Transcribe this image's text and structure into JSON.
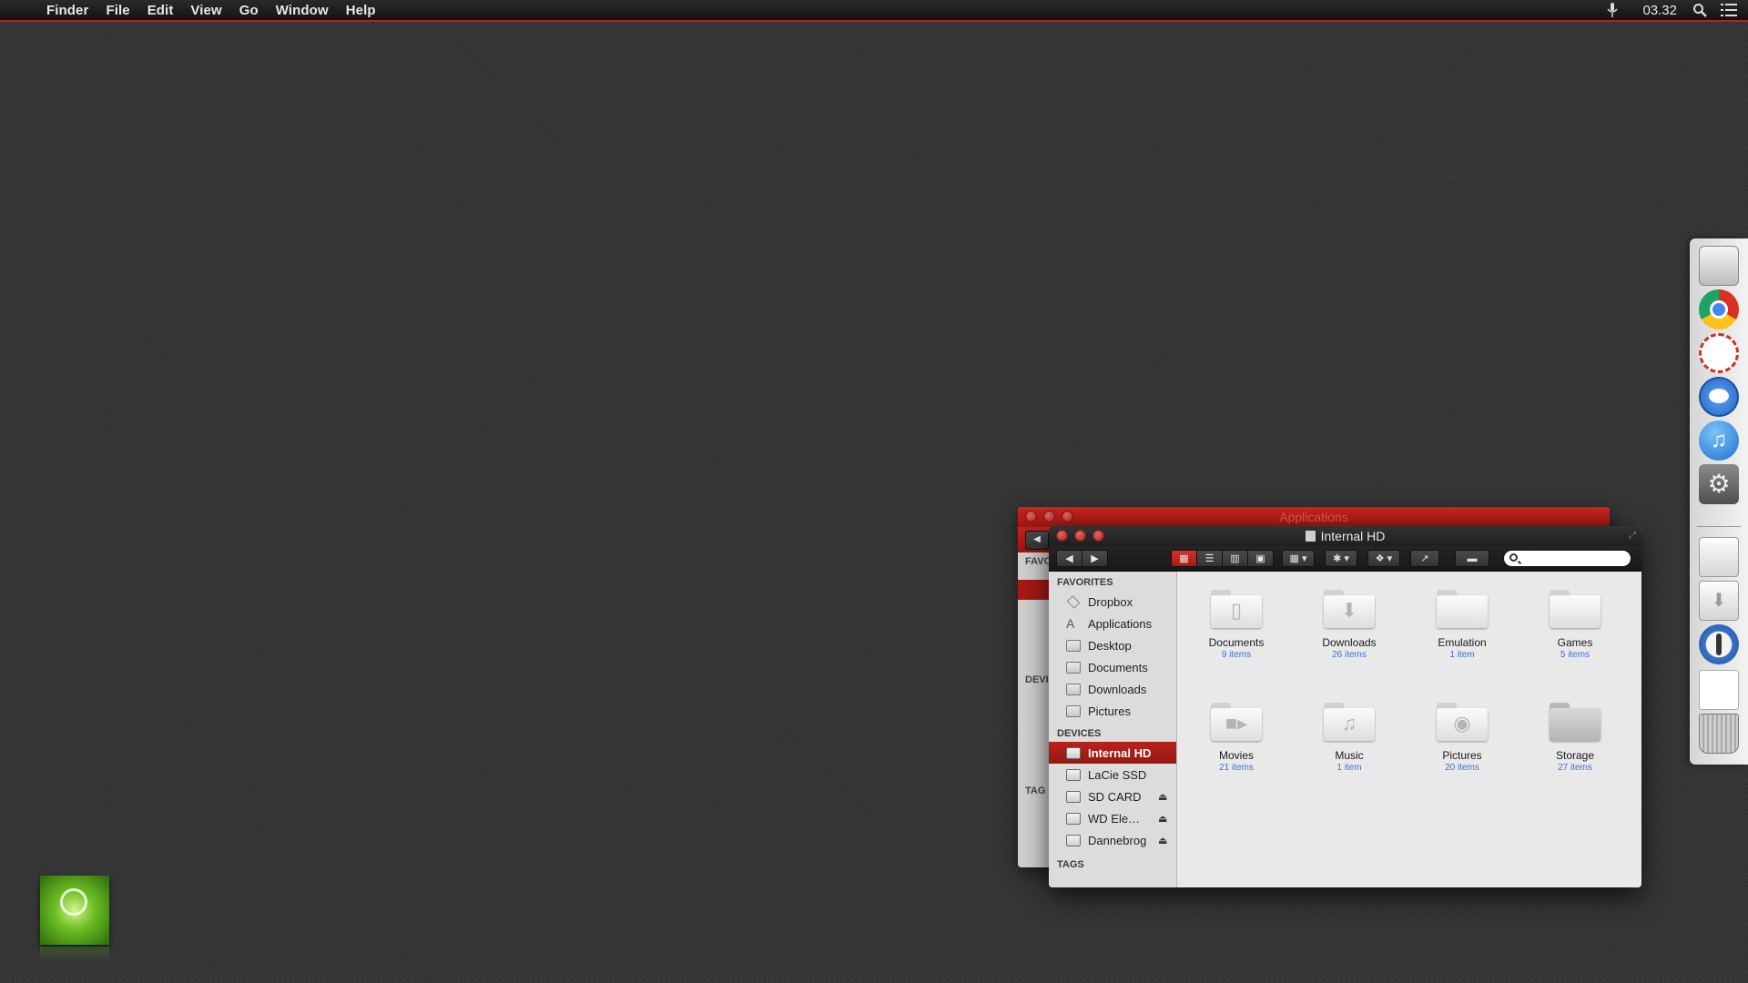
{
  "menubar": {
    "apple": "",
    "items": [
      "Finder",
      "File",
      "Edit",
      "View",
      "Go",
      "Window",
      "Help"
    ],
    "clock": "03.32"
  },
  "back_window": {
    "title": "Applications",
    "sidebar_fav": "FAVO",
    "sidebar_dev": "DEVI",
    "sidebar_tags": "TAG"
  },
  "window": {
    "title": "Internal HD",
    "sidebar": {
      "favorites_header": "FAVORITES",
      "favorites": [
        "Dropbox",
        "Applications",
        "Desktop",
        "Documents",
        "Downloads",
        "Pictures"
      ],
      "devices_header": "DEVICES",
      "devices": [
        "Internal HD",
        "LaCie SSD",
        "SD CARD",
        "WD Ele…",
        "Dannebrog"
      ],
      "tags_header": "TAGS"
    },
    "items": [
      {
        "name": "Documents",
        "count": "9 items"
      },
      {
        "name": "Downloads",
        "count": "26 items"
      },
      {
        "name": "Emulation",
        "count": "1 item"
      },
      {
        "name": "Games",
        "count": "5 items"
      },
      {
        "name": "Movies",
        "count": "21 items"
      },
      {
        "name": "Music",
        "count": "1 item"
      },
      {
        "name": "Pictures",
        "count": "20 items"
      },
      {
        "name": "Storage",
        "count": "27 items"
      }
    ]
  },
  "colors": {
    "accent": "#b3221d",
    "desktop": "#353535",
    "link": "#3a6fd8"
  }
}
